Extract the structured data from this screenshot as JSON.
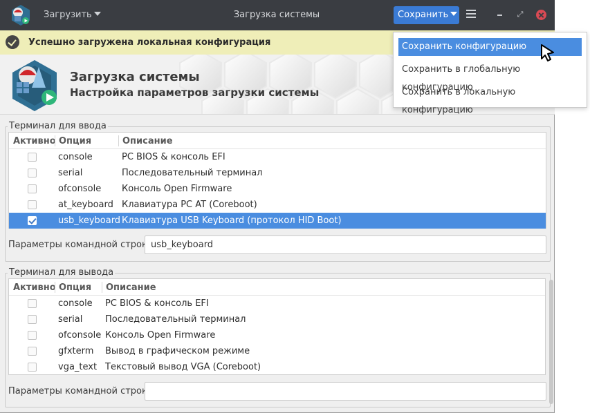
{
  "window": {
    "title": "Загрузка системы",
    "load_label": "Загрузить",
    "save_label": "Сохранить",
    "maximize_glyph": "⤢"
  },
  "notification": {
    "text": "Успешно загружена локальная конфигурация"
  },
  "header": {
    "title": "Загрузка системы",
    "subtitle": "Настройка параметров загрузки системы"
  },
  "input_terminal": {
    "group_label": "Терминал для ввода",
    "columns": [
      "Активно",
      "Опция",
      "Описание"
    ],
    "rows": [
      {
        "active": false,
        "option": "console",
        "description": "PC BIOS & консоль EFI"
      },
      {
        "active": false,
        "option": "serial",
        "description": "Последовательный терминал"
      },
      {
        "active": false,
        "option": "ofconsole",
        "description": "Консоль Open Firmware"
      },
      {
        "active": false,
        "option": "at_keyboard",
        "description": "Клавиатура PC AT (Coreboot)"
      },
      {
        "active": true,
        "option": "usb_keyboard",
        "description": "Клавиатура USB Keyboard (протокол HID Boot)"
      }
    ],
    "cmdline_label": "Параметры командной строки:",
    "cmdline_value": "usb_keyboard"
  },
  "output_terminal": {
    "group_label": "Терминал для вывода",
    "columns": [
      "Активно",
      "Опция",
      "Описание"
    ],
    "rows": [
      {
        "active": false,
        "option": "console",
        "description": "PC BIOS & консоль EFI"
      },
      {
        "active": false,
        "option": "serial",
        "description": "Последовательный терминал"
      },
      {
        "active": false,
        "option": "ofconsole",
        "description": "Консоль Open Firmware"
      },
      {
        "active": false,
        "option": "gfxterm",
        "description": "Вывод в графическом режиме"
      },
      {
        "active": false,
        "option": "vga_text",
        "description": "Текстовый вывод VGA (Coreboot)"
      }
    ],
    "cmdline_label": "Параметры командной строки:",
    "cmdline_value": ""
  },
  "save_menu": {
    "items": [
      {
        "label": "Сохранить конфигурацию",
        "active": true
      },
      {
        "label": "Сохранить в глобальную конфигурацию",
        "active": false
      },
      {
        "label": "Сохранить в локальную конфигурацию",
        "active": false
      }
    ]
  },
  "colors": {
    "titlebar": "#3a3d42",
    "accent": "#4a8de0",
    "save_button": "#3a7bd5",
    "notice": "#efeeb8",
    "close": "#d94a54"
  },
  "icons": [
    "app-logo-icon",
    "caret-down-icon",
    "hamburger-menu-icon",
    "minimize-icon",
    "maximize-icon",
    "close-icon",
    "check-circle-icon",
    "checkbox-icon",
    "mouse-pointer-icon"
  ]
}
